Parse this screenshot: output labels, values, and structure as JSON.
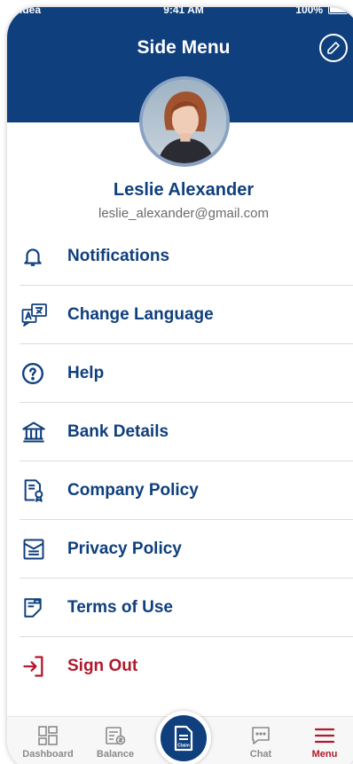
{
  "status_bar": {
    "carrier": "Idea",
    "time": "9:41 AM",
    "battery": "100%"
  },
  "header": {
    "title": "Side Menu"
  },
  "user": {
    "name": "Leslie Alexander",
    "email": "leslie_alexander@gmail.com"
  },
  "menu": {
    "items": [
      {
        "label": "Notifications",
        "icon": "bell-icon"
      },
      {
        "label": "Change Language",
        "icon": "translate-icon"
      },
      {
        "label": "Help",
        "icon": "help-icon"
      },
      {
        "label": "Bank Details",
        "icon": "bank-icon"
      },
      {
        "label": "Company Policy",
        "icon": "policy-badge-icon"
      },
      {
        "label": "Privacy Policy",
        "icon": "privacy-doc-icon"
      },
      {
        "label": "Terms of Use",
        "icon": "terms-doc-icon"
      },
      {
        "label": "Sign Out",
        "icon": "sign-out-icon"
      }
    ]
  },
  "tabbar": {
    "tabs": [
      {
        "label": "Dashboard",
        "icon": "dashboard-icon"
      },
      {
        "label": "Balance",
        "icon": "balance-icon"
      },
      {
        "label": "Claim",
        "icon": "claim-icon"
      },
      {
        "label": "Chat",
        "icon": "chat-icon"
      },
      {
        "label": "Menu",
        "icon": "menu-icon",
        "active": true
      }
    ]
  },
  "colors": {
    "primary": "#0f3f7d",
    "danger": "#b01a2c",
    "muted": "#8a8a8a"
  }
}
